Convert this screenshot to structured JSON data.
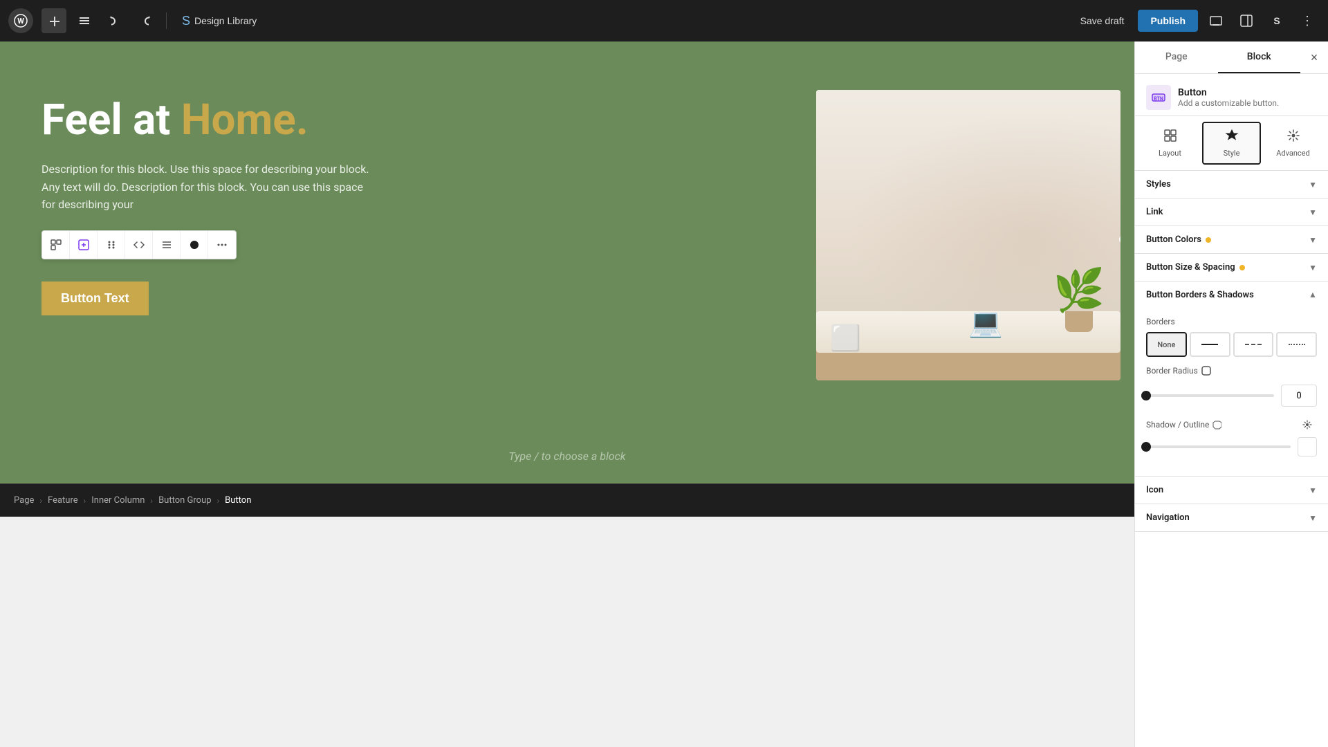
{
  "toolbar": {
    "wp_logo": "W",
    "add_label": "+",
    "brush_label": "✏",
    "undo_label": "↩",
    "redo_label": "↪",
    "list_label": "☰",
    "design_library": "Design Library",
    "save_draft": "Save draft",
    "publish": "Publish",
    "view_icon": "🖥",
    "panel_icon": "▣",
    "storybook_icon": "S",
    "more_icon": "⋮"
  },
  "canvas": {
    "heading": "Feel at ",
    "heading_highlight": "Home.",
    "description": "Description for this block. Use this space for describing your block. Any text will do. Description for this block. You can use this space for describing your",
    "button_text": "Button Text",
    "type_placeholder": "Type / to choose a block"
  },
  "block_toolbar": {
    "tools": [
      "⊞",
      "⌂",
      "⋮⋮⋮",
      "<>",
      "≡",
      "●",
      "⋯"
    ]
  },
  "sidebar": {
    "tabs": [
      "Page",
      "Block"
    ],
    "active_tab": "Block",
    "close_icon": "×",
    "block_name": "Button",
    "block_desc": "Add a customizable button.",
    "style_tabs": [
      {
        "icon": "⊞",
        "label": "Layout"
      },
      {
        "icon": "✦",
        "label": "Style"
      },
      {
        "icon": "⚙",
        "label": "Advanced"
      }
    ],
    "active_style_tab": "Style",
    "sections": [
      {
        "id": "styles",
        "title": "Styles",
        "has_dot": false,
        "open": false
      },
      {
        "id": "link",
        "title": "Link",
        "has_dot": false,
        "open": false
      },
      {
        "id": "button_colors",
        "title": "Button Colors",
        "has_dot": true,
        "open": false
      },
      {
        "id": "button_size",
        "title": "Button Size & Spacing",
        "has_dot": true,
        "open": false
      },
      {
        "id": "button_borders",
        "title": "Button Borders & Shadows",
        "has_dot": false,
        "open": true
      },
      {
        "id": "icon",
        "title": "Icon",
        "has_dot": false,
        "open": false
      },
      {
        "id": "navigation",
        "title": "Navigation",
        "has_dot": false,
        "open": false
      }
    ],
    "borders": {
      "label": "Borders",
      "options": [
        "None",
        "—",
        "- - -",
        "····"
      ],
      "active": "None"
    },
    "border_radius": {
      "label": "Border Radius",
      "value": "0",
      "slider_percent": 0
    },
    "shadow": {
      "label": "Shadow / Outline",
      "slider_percent": 0
    }
  },
  "breadcrumb": {
    "items": [
      "Page",
      "Feature",
      "Inner Column",
      "Button Group",
      "Button"
    ]
  }
}
